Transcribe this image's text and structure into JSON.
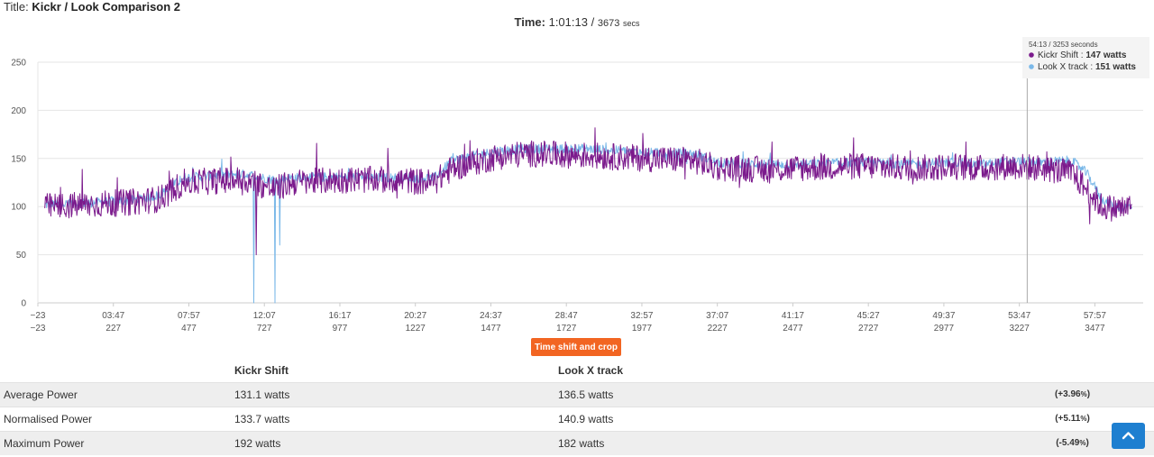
{
  "header": {
    "title_prefix": "Title:",
    "title": "Kickr / Look Comparison 2",
    "time_label": "Time:",
    "time_value": "1:01:13",
    "time_sep": "/",
    "time_secs": "3673",
    "time_unit": "secs"
  },
  "tooltip": {
    "time_mmss": "54:13",
    "sep": "/",
    "secs": "3253",
    "secs_unit": "seconds",
    "items": [
      {
        "name": "Kickr Shift",
        "value": "147 watts",
        "color": "#7b1a8c"
      },
      {
        "name": "Look X track",
        "value": "151 watts",
        "color": "#7ab8e8"
      }
    ]
  },
  "chart_data": {
    "type": "line",
    "ylim": [
      0,
      250
    ],
    "y_ticks": [
      0,
      50,
      100,
      150,
      200,
      250
    ],
    "x_ticks_time": [
      "−23",
      "03:47",
      "07:57",
      "12:07",
      "16:17",
      "20:27",
      "24:37",
      "28:47",
      "32:57",
      "37:07",
      "41:17",
      "45:27",
      "49:37",
      "53:47",
      "57:57"
    ],
    "x_ticks_secs": [
      "−23",
      "227",
      "477",
      "727",
      "977",
      "1227",
      "1477",
      "1727",
      "1977",
      "2227",
      "2477",
      "2727",
      "2977",
      "3227",
      "3477"
    ],
    "x_range_secs": [
      -23,
      3637
    ],
    "cursor_secs": 3253,
    "grid": true,
    "series": [
      {
        "name": "Kickr Shift",
        "color": "#7b1a8c",
        "x": [
          0,
          150,
          300,
          380,
          460,
          640,
          700,
          720,
          760,
          820,
          1000,
          1150,
          1290,
          1350,
          1500,
          1600,
          1800,
          2000,
          2150,
          2230,
          2300,
          2400,
          2500,
          2700,
          2900,
          3000,
          3100,
          3200,
          3300,
          3400,
          3450,
          3500,
          3550,
          3600
        ],
        "values": [
          100,
          102,
          105,
          108,
          125,
          128,
          125,
          122,
          118,
          125,
          128,
          128,
          125,
          140,
          152,
          155,
          153,
          150,
          148,
          140,
          140,
          138,
          140,
          142,
          140,
          142,
          140,
          142,
          140,
          135,
          118,
          100,
          98,
          100
        ]
      },
      {
        "name": "Look X track",
        "color": "#7ab8e8",
        "x": [
          0,
          150,
          300,
          380,
          460,
          640,
          700,
          720,
          760,
          820,
          1000,
          1150,
          1290,
          1350,
          1500,
          1600,
          1800,
          2000,
          2150,
          2230,
          2300,
          2400,
          2500,
          2700,
          2900,
          3000,
          3100,
          3200,
          3300,
          3400,
          3450,
          3500,
          3550,
          3600
        ],
        "values": [
          102,
          104,
          107,
          112,
          130,
          134,
          132,
          130,
          128,
          130,
          131,
          130,
          130,
          148,
          158,
          160,
          160,
          156,
          155,
          145,
          145,
          144,
          144,
          146,
          144,
          146,
          144,
          147,
          146,
          148,
          135,
          108,
          100,
          100
        ]
      }
    ]
  },
  "buttons": {
    "crop": "Time shift and crop"
  },
  "table": {
    "headers": [
      "",
      "Kickr Shift",
      "Look X track",
      ""
    ],
    "rows": [
      {
        "label": "Average Power",
        "a": "131.1 watts",
        "b": "136.5 watts",
        "pct": "+3.96",
        "pct_unit": "%"
      },
      {
        "label": "Normalised Power",
        "a": "133.7 watts",
        "b": "140.9 watts",
        "pct": "+5.11",
        "pct_unit": "%"
      },
      {
        "label": "Maximum Power",
        "a": "192 watts",
        "b": "182 watts",
        "pct": "-5.49",
        "pct_unit": "%"
      }
    ]
  }
}
